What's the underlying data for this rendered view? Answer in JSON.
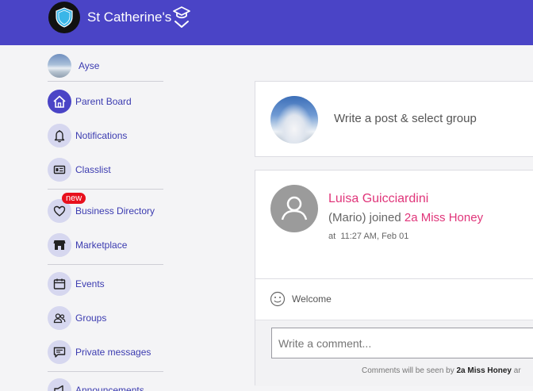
{
  "header": {
    "school_name": "St Catherine's"
  },
  "sidebar": {
    "user_name": "Ayse",
    "items": [
      {
        "label": "Parent Board"
      },
      {
        "label": "Notifications"
      },
      {
        "label": "Classlist"
      },
      {
        "label": "Business Directory",
        "badge": "new"
      },
      {
        "label": "Marketplace"
      },
      {
        "label": "Events"
      },
      {
        "label": "Groups"
      },
      {
        "label": "Private messages"
      },
      {
        "label": "Announcements"
      }
    ]
  },
  "composer": {
    "prompt": "Write a post & select group"
  },
  "post": {
    "author": "Luisa Guicciardini",
    "text_prefix": "(Mario) joined",
    "group": "2a Miss Honey",
    "time_prefix": "at",
    "time": "11:27 AM, Feb 01",
    "reaction_label": "Welcome",
    "comment_placeholder": "Write a comment...",
    "note_prefix": "Comments will be seen by",
    "note_group": "2a Miss Honey",
    "note_suffix": "ar"
  },
  "colors": {
    "brand": "#4a44c6",
    "accent_pink": "#e0357a",
    "badge_red": "#e8101c"
  }
}
